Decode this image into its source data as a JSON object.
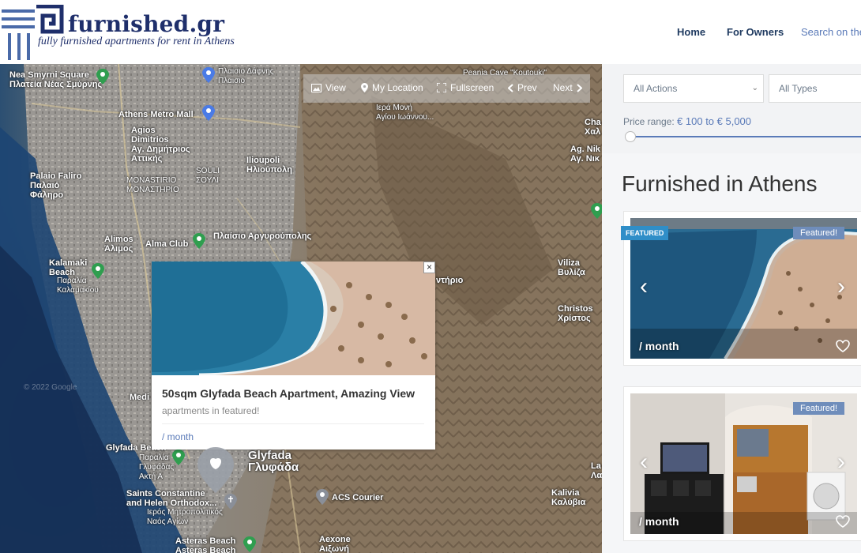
{
  "brand": {
    "name": "furnished.gr",
    "tagline": "fully furnished apartments for rent in Athens"
  },
  "nav": {
    "home": "Home",
    "owners": "For Owners",
    "search": "Search on the"
  },
  "map": {
    "toolbar": {
      "view": "View",
      "my_location": "My Location",
      "fullscreen": "Fullscreen",
      "prev": "Prev",
      "next": "Next"
    },
    "copyright": "© 2022 Google",
    "labels": [
      "Nea Smyrni Square\nΠλατεία Νέας Σμύρνης",
      "Πλαισιο Δάφνης\nΠλαισιο",
      "Athens Metro Mall",
      "Agios\nDimitrios\nΑγ. Δημήτριος\nΑττικής",
      "Palaio Faliro\nΠαλαιό\nΦάληρο",
      "MONASTIRIO\nΜΟΝΑΣΤΗΡΙΟ",
      "SOULI\nΣΟΥΛΙ",
      "Ilioupoli\nΗλιούπολη",
      "Alimos\nΆλιμος",
      "Alma Club",
      "Πλαίσιο Αργυρούπολης",
      "Kalamaki\nBeach",
      "Παραλία\nΚαλαμακίου",
      "Peania Cave \"Koutouki\"",
      "Ιερά Μονή\nΑγίου Ιωάννου...",
      "Cha\nΧαλ",
      "Ag. Nik\nΑγ. Νικ",
      "Viliza\nΒυλίζα",
      "Christos\nΧρίστος",
      "Glyfada Beach",
      "Παραλία\nΓλυφάδας\nΑκτή Α",
      "Glyfada\nΓλυφάδα",
      "Saints Constantine\nand Helen Orthodox...",
      "Ιερός Μητροπολιτικός\nΝαός Αγίων",
      "ACS Courier",
      "Kalivia\nΚαλύβια",
      "Asteras Beach\nAsteras Beach",
      "Aexone\nΑιξωνή",
      "Medi",
      "ντήριο",
      "La\nΛα"
    ]
  },
  "popup": {
    "close": "×",
    "title": "50sqm Glyfada Beach Apartment, Amazing View",
    "subtitle": "apartments in featured!",
    "price": "/ month"
  },
  "filters": {
    "actions": "All Actions",
    "types": "All Types",
    "price_label": "Price range:",
    "price_value": "€ 100 to € 5,000"
  },
  "listing": {
    "title": "Furnished in Athens",
    "cards": [
      {
        "badge": "FEATURED",
        "featured": "Featured!",
        "price": "/ month"
      },
      {
        "featured": "Featured!",
        "price": "/ month"
      }
    ]
  }
}
